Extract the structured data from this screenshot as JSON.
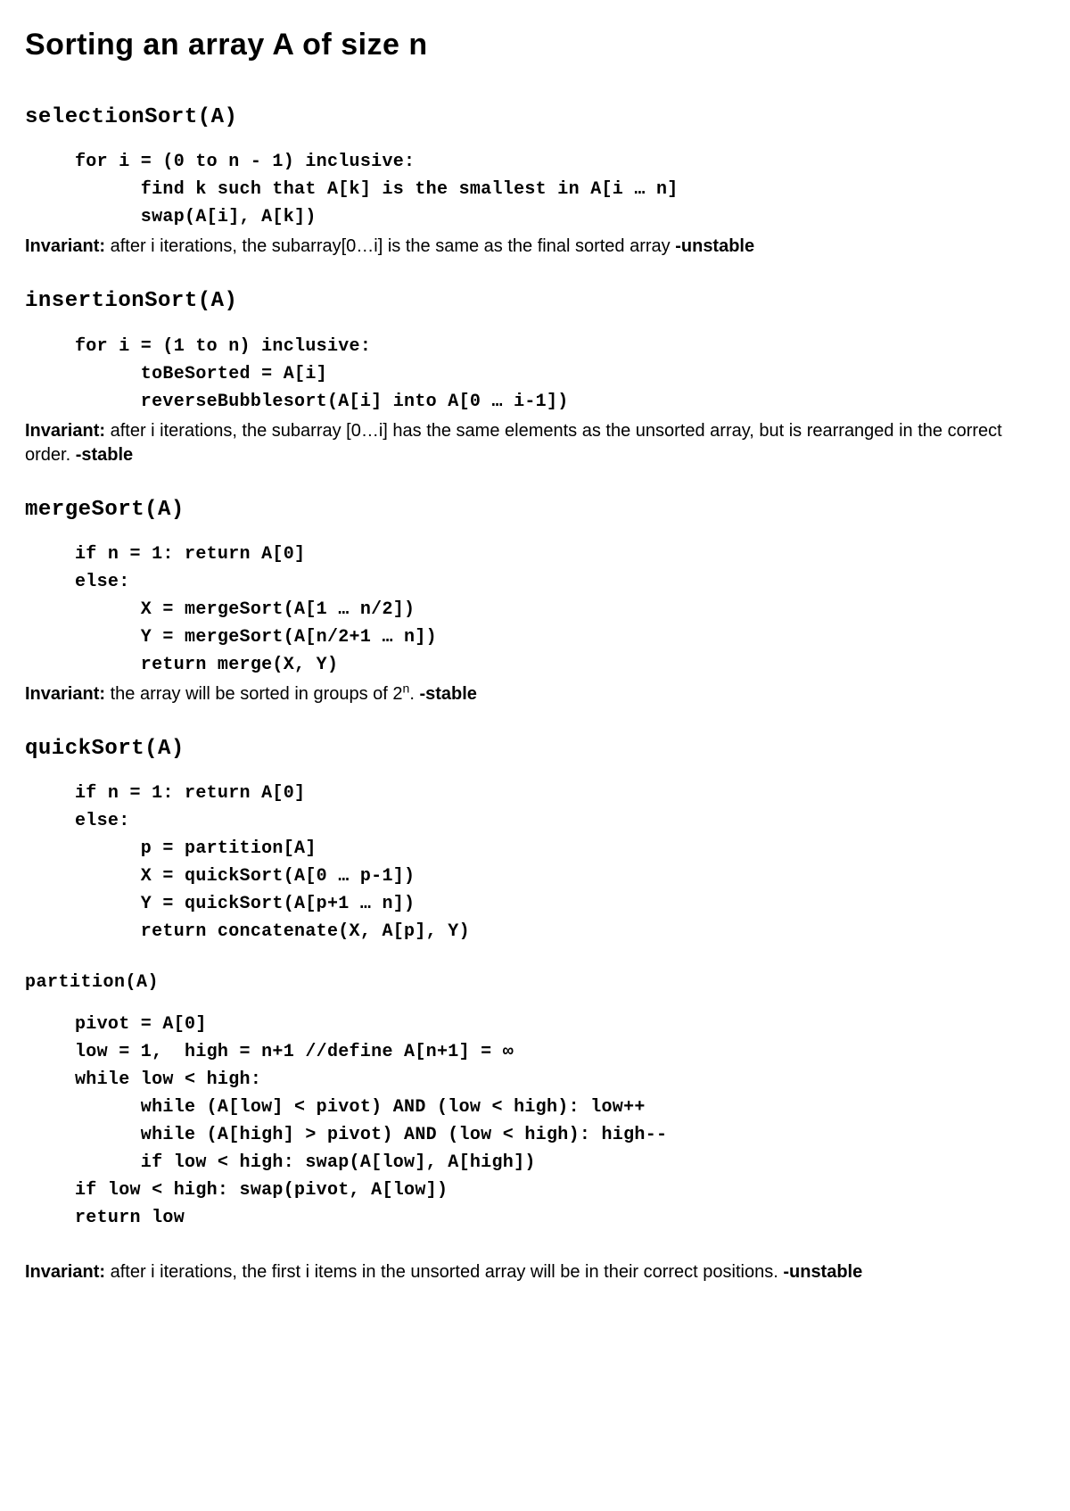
{
  "title": "Sorting an array A of size n",
  "invariant_label": "Invariant:",
  "sections": {
    "selection": {
      "heading": "selectionSort(A)",
      "code": "for i = (0 to n - 1) inclusive:\n      find k such that A[k] is the smallest in A[i … n]\n      swap(A[i], A[k])",
      "invariant_text": " after i iterations, the subarray[0…i] is the same as the final sorted array ",
      "stability": "-unstable"
    },
    "insertion": {
      "heading": "insertionSort(A)",
      "code": "for i = (1 to n) inclusive:\n      toBeSorted = A[i]\n      reverseBubblesort(A[i] into A[0 … i-1])",
      "invariant_text": " after i iterations, the subarray [0…i] has the same elements as the unsorted array, but is rearranged in the correct order. ",
      "stability": "-stable"
    },
    "merge": {
      "heading": "mergeSort(A)",
      "code": "if n = 1: return A[0]\nelse:\n      X = mergeSort(A[1 … n/2])\n      Y = mergeSort(A[n/2+1 … n])\n      return merge(X, Y)",
      "invariant_pre": " the array will be sorted in groups of 2",
      "invariant_sup": "n",
      "invariant_post": ". ",
      "stability": "-stable"
    },
    "quick": {
      "heading": "quickSort(A)",
      "code": "if n = 1: return A[0]\nelse:\n      p = partition[A]\n      X = quickSort(A[0 … p-1])\n      Y = quickSort(A[p+1 … n])\n      return concatenate(X, A[p], Y)",
      "partition_heading": "partition(A)",
      "partition_code": "pivot = A[0]\nlow = 1,  high = n+1 //define A[n+1] = ∞\nwhile low < high:\n      while (A[low] < pivot) AND (low < high): low++\n      while (A[high] > pivot) AND (low < high): high--\n      if low < high: swap(A[low], A[high])\nif low < high: swap(pivot, A[low])\nreturn low",
      "invariant_text": " after i iterations, the first i items in the unsorted array will be in their correct positions. ",
      "stability": "-unstable"
    }
  }
}
